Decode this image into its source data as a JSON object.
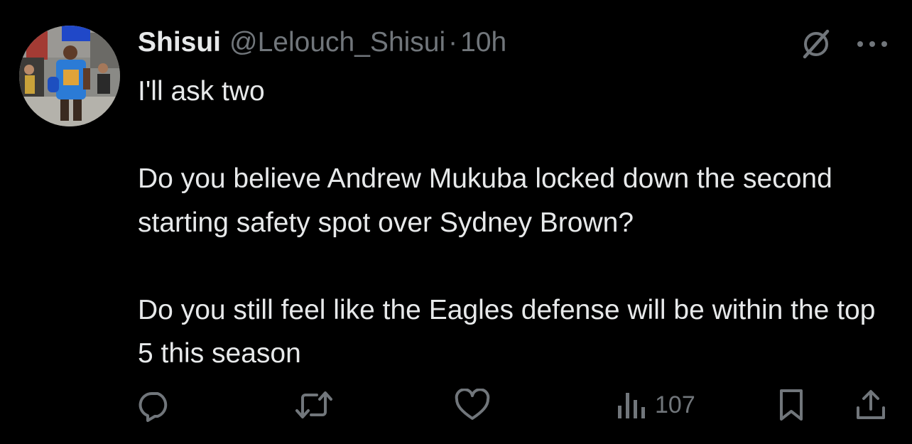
{
  "tweet": {
    "author": {
      "display_name": "Shisui",
      "handle": "@Lelouch_Shisui",
      "separator": "·",
      "time": "10h"
    },
    "paragraphs": [
      "I'll ask two",
      "Do you believe Andrew Mukuba locked down the second starting safety spot over Sydney Brown?",
      "Do you still feel like the Eagles defense will be within the top 5 this season"
    ],
    "actions": {
      "reply_icon": "reply-icon",
      "retweet_icon": "retweet-icon",
      "like_icon": "like-icon",
      "views_icon": "views-icon",
      "views_count": "107",
      "bookmark_icon": "bookmark-icon",
      "share_icon": "share-icon"
    },
    "top_icons": [
      "grok-icon",
      "more-icon"
    ]
  },
  "colors": {
    "background": "#000000",
    "text_primary": "#e7e9ea",
    "text_secondary": "#71767b"
  }
}
